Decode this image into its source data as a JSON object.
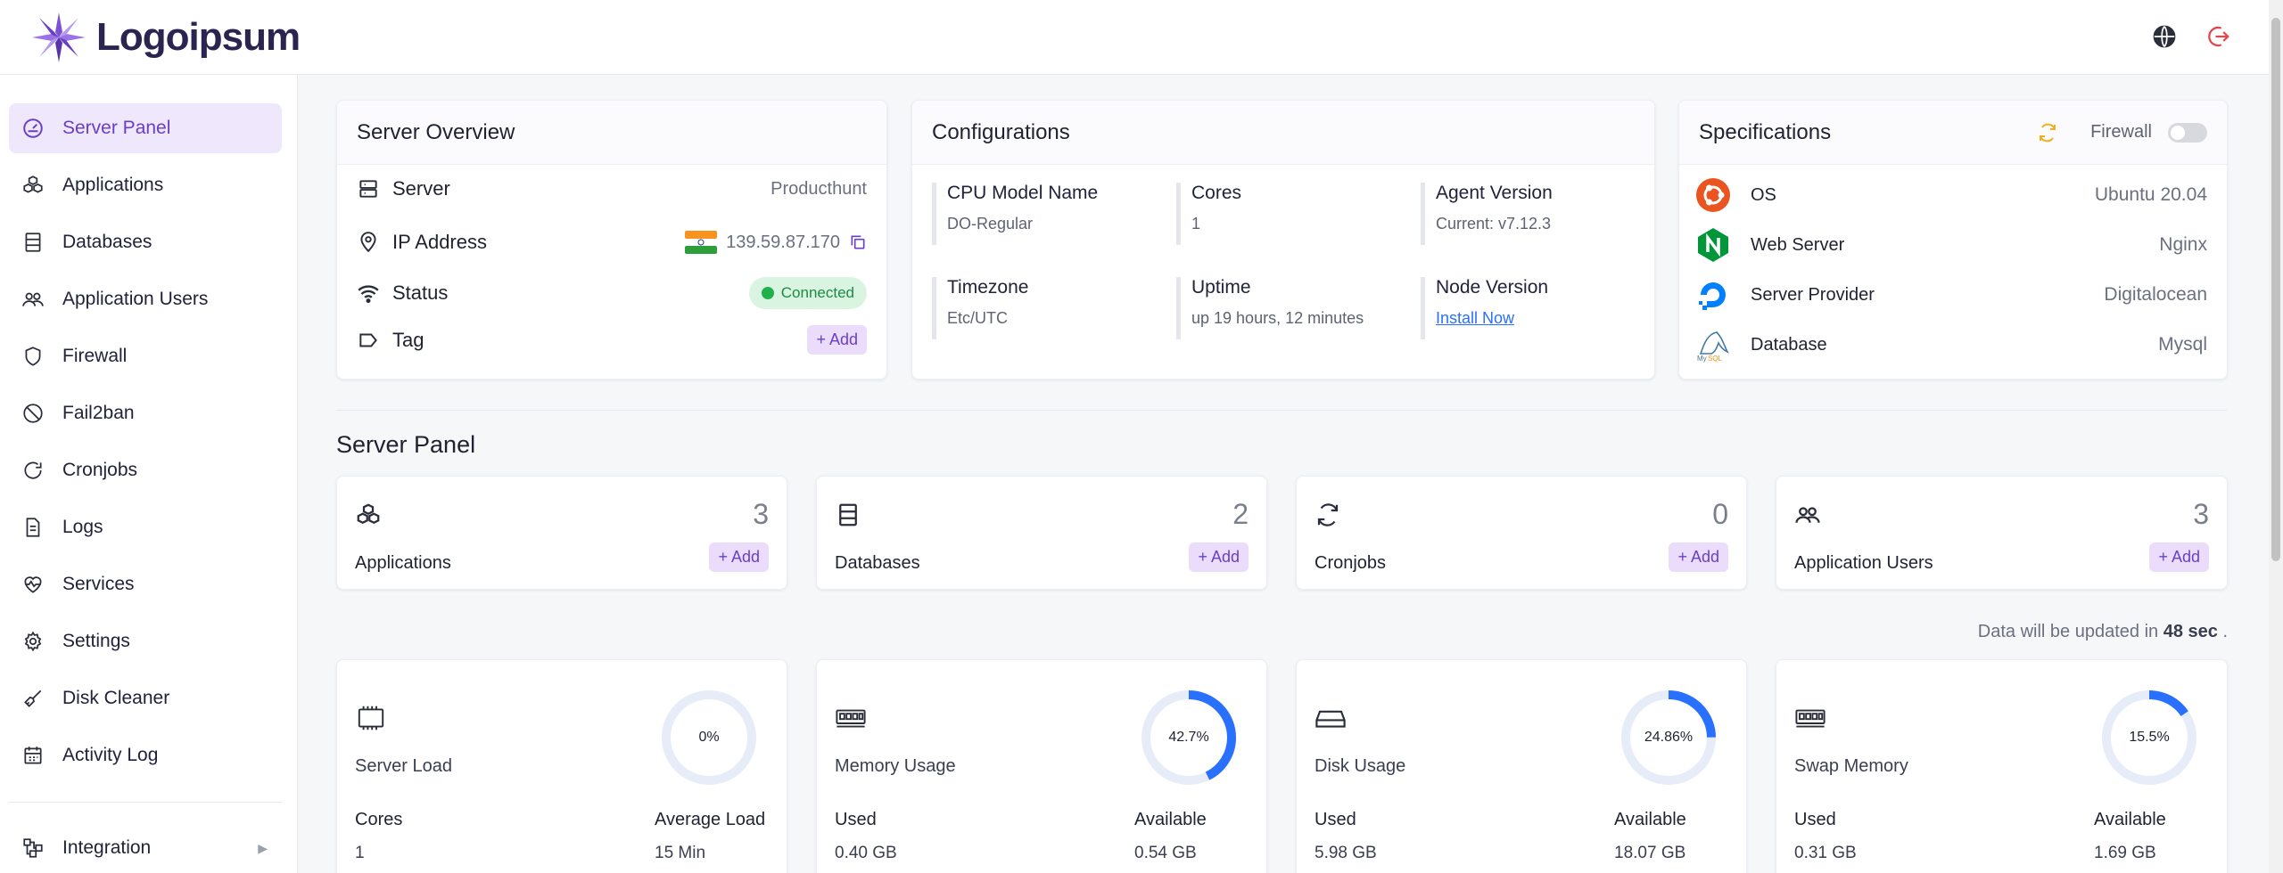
{
  "brand": {
    "name": "Logoipsum"
  },
  "header": {
    "icons": [
      "globe-icon",
      "logout-icon"
    ],
    "logout_color": "#e0484c"
  },
  "sidebar": {
    "items": [
      {
        "label": "Server Panel",
        "icon": "gauge-icon",
        "active": true
      },
      {
        "label": "Applications",
        "icon": "cubes-icon"
      },
      {
        "label": "Databases",
        "icon": "database-icon"
      },
      {
        "label": "Application Users",
        "icon": "users-icon"
      },
      {
        "label": "Firewall",
        "icon": "shield-icon"
      },
      {
        "label": "Fail2ban",
        "icon": "ban-icon"
      },
      {
        "label": "Cronjobs",
        "icon": "refresh-icon"
      },
      {
        "label": "Logs",
        "icon": "file-icon"
      },
      {
        "label": "Services",
        "icon": "heartbeat-icon"
      },
      {
        "label": "Settings",
        "icon": "gear-icon"
      },
      {
        "label": "Disk Cleaner",
        "icon": "broom-icon"
      },
      {
        "label": "Activity Log",
        "icon": "calendar-icon"
      }
    ],
    "integration": {
      "label": "Integration",
      "icon": "integration-icon"
    }
  },
  "overview": {
    "title": "Server Overview",
    "server_label": "Server",
    "server_value": "Producthunt",
    "ip_label": "IP Address",
    "ip_value": "139.59.87.170",
    "status_label": "Status",
    "status_value": "Connected",
    "tag_label": "Tag",
    "tag_add": "+ Add"
  },
  "configurations": {
    "title": "Configurations",
    "cells": [
      {
        "key": "CPU Model Name",
        "value": "DO-Regular"
      },
      {
        "key": "Cores",
        "value": "1"
      },
      {
        "key": "Agent Version",
        "value": "Current: v7.12.3"
      },
      {
        "key": "Timezone",
        "value": "Etc/UTC"
      },
      {
        "key": "Uptime",
        "value": "up 19 hours, 12 minutes"
      },
      {
        "key": "Node Version",
        "value": "Install Now"
      }
    ]
  },
  "specifications": {
    "title": "Specifications",
    "firewall_label": "Firewall",
    "rows": [
      {
        "key": "OS",
        "value": "Ubuntu 20.04",
        "icon": "ubuntu-icon"
      },
      {
        "key": "Web Server",
        "value": "Nginx",
        "icon": "nginx-icon"
      },
      {
        "key": "Server Provider",
        "value": "Digitalocean",
        "icon": "digitalocean-icon"
      },
      {
        "key": "Database",
        "value": "Mysql",
        "icon": "mysql-icon"
      }
    ]
  },
  "panel": {
    "title": "Server Panel",
    "stats": [
      {
        "label": "Applications",
        "count": "3",
        "add": "+ Add"
      },
      {
        "label": "Databases",
        "count": "2",
        "add": "+ Add"
      },
      {
        "label": "Cronjobs",
        "count": "0",
        "add": "+ Add"
      },
      {
        "label": "Application Users",
        "count": "3",
        "add": "+ Add"
      }
    ]
  },
  "update_note": {
    "prefix": "Data will be updated in",
    "seconds": "48 sec",
    "suffix": "."
  },
  "resources": [
    {
      "label": "Server Load",
      "percent_text": "0%",
      "percent": 0,
      "left_key": "Cores",
      "left_val": "1",
      "right_key": "Average Load",
      "right_val": "15 Min"
    },
    {
      "label": "Memory Usage",
      "percent_text": "42.7%",
      "percent": 42.7,
      "left_key": "Used",
      "left_val": "0.40 GB",
      "right_key": "Available",
      "right_val": "0.54 GB"
    },
    {
      "label": "Disk Usage",
      "percent_text": "24.86%",
      "percent": 24.86,
      "left_key": "Used",
      "left_val": "5.98 GB",
      "right_key": "Available",
      "right_val": "18.07 GB"
    },
    {
      "label": "Swap Memory",
      "percent_text": "15.5%",
      "percent": 15.5,
      "left_key": "Used",
      "left_val": "0.31 GB",
      "right_key": "Available",
      "right_val": "1.69 GB"
    }
  ],
  "colors": {
    "accent": "#6a3fc6",
    "accent_bg": "#efe7fb",
    "donut": "#2970ff",
    "donut_track": "#e6ecf8",
    "connected": "#22b04f"
  }
}
